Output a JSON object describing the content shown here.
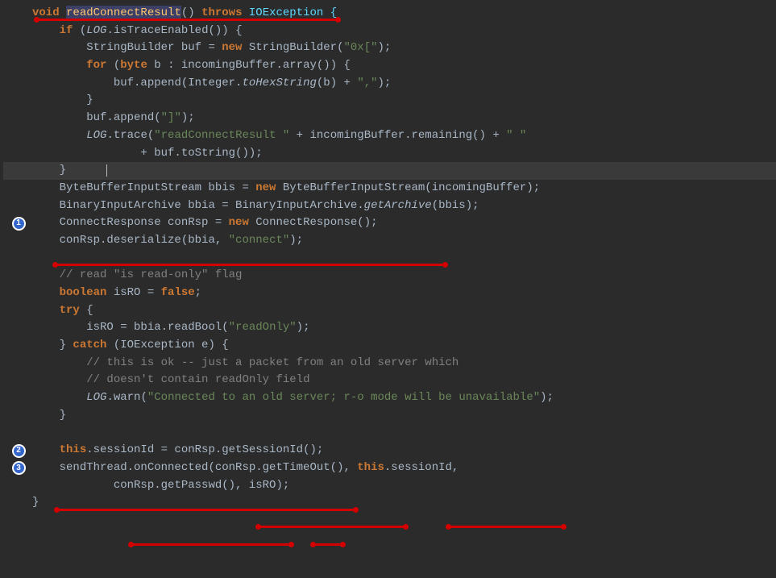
{
  "badges": {
    "b1": "1",
    "b2": "2",
    "b3": "3"
  },
  "code": {
    "l1_a": "void",
    "l1_b": "readConnectResult",
    "l1_c": "() ",
    "l1_d": "throws",
    "l1_e": " IOException {",
    "l2_a": "if",
    "l2_b": " (",
    "l2_c": "LOG",
    "l2_d": ".isTraceEnabled()) {",
    "l3_a": "StringBuilder buf = ",
    "l3_b": "new",
    "l3_c": " StringBuilder(",
    "l3_d": "\"0x[\"",
    "l3_e": ");",
    "l4_a": "for",
    "l4_b": " (",
    "l4_c": "byte",
    "l4_d": " b : incomingBuffer.array()) {",
    "l5_a": "buf.append(Integer.",
    "l5_b": "toHexString",
    "l5_c": "(b) + ",
    "l5_d": "\",\"",
    "l5_e": ");",
    "l6_a": "}",
    "l7_a": "buf.append(",
    "l7_b": "\"]\"",
    "l7_c": ");",
    "l8_a": "LOG",
    "l8_b": ".trace(",
    "l8_c": "\"readConnectResult \"",
    "l8_d": " + incomingBuffer.remaining() + ",
    "l8_e": "\" \"",
    "l9_a": "+ buf.toString());",
    "l10_a": "}",
    "l11_a": "ByteBufferInputStream bbis = ",
    "l11_b": "new",
    "l11_c": " ByteBufferInputStream(incomingBuffer);",
    "l12_a": "BinaryInputArchive bbia = BinaryInputArchive.",
    "l12_b": "getArchive",
    "l12_c": "(bbis);",
    "l13_a": "ConnectResponse conRsp = ",
    "l13_b": "new",
    "l13_c": " ConnectResponse();",
    "l14_a": "conRsp.deserialize(bbia, ",
    "l14_b": "\"connect\"",
    "l14_c": ");",
    "l16_a": "// read \"is read-only\" flag",
    "l17_a": "boolean",
    "l17_b": " isRO = ",
    "l17_c": "false",
    "l17_d": ";",
    "l18_a": "try",
    "l18_b": " {",
    "l19_a": "isRO = bbia.readBool(",
    "l19_b": "\"readOnly\"",
    "l19_c": ");",
    "l20_a": "} ",
    "l20_b": "catch",
    "l20_c": " (IOException e) {",
    "l21_a": "// this is ok -- just a packet from an old server which",
    "l22_a": "// doesn't contain readOnly field",
    "l23_a": "LOG",
    "l23_b": ".warn(",
    "l23_c": "\"Connected to an old server; r-o mode will be unavailable\"",
    "l23_d": ");",
    "l24_a": "}",
    "l26_a": "this",
    "l26_b": ".sessionId = conRsp.getSessionId();",
    "l27_a": "sendThread.onConnected(conRsp.getTimeOut(), ",
    "l27_b": "this",
    "l27_c": ".sessionId,",
    "l28_a": "conRsp.getPasswd(), isRO);",
    "l29_a": "}"
  }
}
